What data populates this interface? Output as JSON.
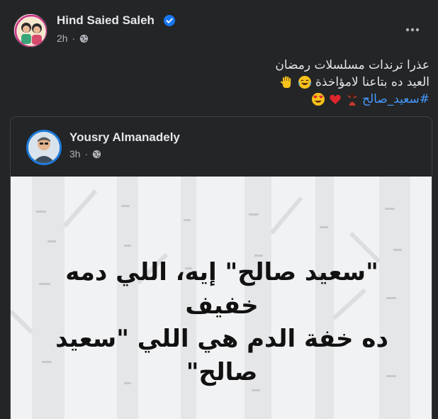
{
  "post": {
    "author": "Hind Saied Saleh",
    "time": "2h",
    "caption_line1": "عذرا ترندات مسلسلات رمضان",
    "caption_line2": "العيد ده بتاعنا لامؤاخذة",
    "hashtag": "#سعيد_صالح"
  },
  "shared_post": {
    "author": "Yousry Almanadely",
    "time": "3h",
    "quote_line1": "\"سعيد صالح\" إيه، اللي دمه",
    "quote_line2": "خفيف",
    "quote_line3": "ده خفة الدم هي اللي \"سعيد",
    "quote_line4": "صالح\""
  },
  "icons": {
    "verified": "verified-badge-icon",
    "globe": "globe-icon",
    "more": "more-options-icon"
  },
  "colors": {
    "background": "#242526",
    "text": "#e4e6eb",
    "muted": "#b0b3b8",
    "link": "#4599ff",
    "verified": "#1877f2"
  }
}
